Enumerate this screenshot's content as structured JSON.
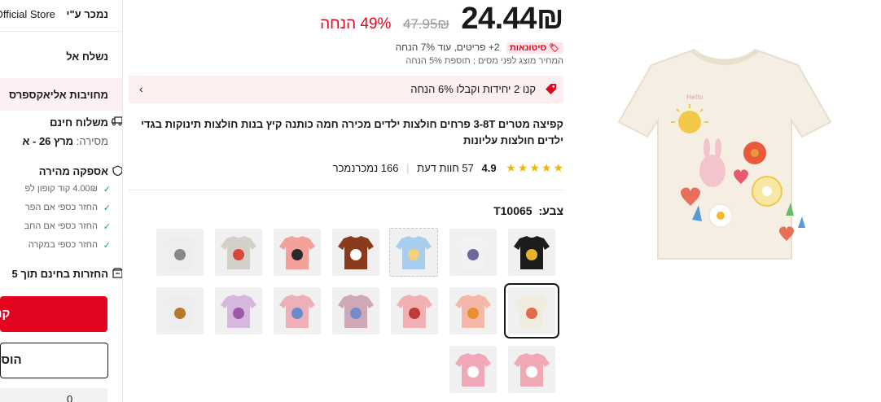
{
  "left": {
    "seller_label": "נמכר ע\"י",
    "store_name": "Official Store",
    "ship_to": "נשלח אל",
    "commitment": "מחויבות אליאקספרס",
    "free_shipping": "משלוח חינם",
    "delivery_label": "מסירה:",
    "delivery_date": "מרץ 26 - א",
    "fast_delivery": "אספקה מהירה",
    "benefits": [
      "4.00₪ קוד קופון לפ",
      "החזר כספי אם הפר",
      "החזר כספי אם החב",
      "החזר כספי במקרה"
    ],
    "free_returns": "החזרות בחינם תוך 5",
    "buy_label": "קנ",
    "add_label": "הוסי",
    "qty": "0"
  },
  "price": {
    "current": "24.44₪",
    "original": "47.95₪",
    "discount": "49% הנחה",
    "wholesale_badge": "סיטונאות",
    "wholesale_text": "2+ פריטים, עוד 7% הנחה",
    "tax_note": "המחיר מוצג לפני מסים ; תוספת 5% הנחה"
  },
  "coupon": {
    "text": "קנו 2 יחידות וקבלו 6% הנחה"
  },
  "product": {
    "title": "קפיצה מטרים 3-8T פרחים חולצות ילדים מכירה חמה כותנה קיץ בנות חולצות תינוקות בגדי ילדים חולצות עליונות",
    "rating": "4.9",
    "reviews": "57 חוות דעת",
    "sold": "166 נמכרנמכר"
  },
  "color": {
    "label": "צבע:",
    "value": "T10065"
  },
  "colors": {
    "accent": "#e3051f",
    "pink_bg": "#fdeef0",
    "star": "#f5b400",
    "check": "#1a9d5a"
  },
  "swatches": [
    {
      "name": "black-leopard",
      "shirt": "#1c1c1c",
      "accent": "#e8b430"
    },
    {
      "name": "white-butterfly",
      "shirt": "#f2f2f4",
      "accent": "#6a6a9a"
    },
    {
      "name": "blue-unicorn",
      "shirt": "#a9cdee",
      "accent": "#f2d27a"
    },
    {
      "name": "brown-zebra",
      "shirt": "#8a3b1e",
      "accent": "#ffffff"
    },
    {
      "name": "pink-toucan",
      "shirt": "#f2a099",
      "accent": "#2a2a2a"
    },
    {
      "name": "gray-flowers",
      "shirt": "#d2d0c8",
      "accent": "#d8463c"
    },
    {
      "name": "white-dancer",
      "shirt": "#ededed",
      "accent": "#888"
    },
    {
      "name": "cream-flowers",
      "shirt": "#f2ece0",
      "accent": "#e36a4a"
    },
    {
      "name": "peach-fox",
      "shirt": "#f4b8a8",
      "accent": "#e89030"
    },
    {
      "name": "pink-butterfly",
      "shirt": "#f2b0b2",
      "accent": "#c03a3a"
    },
    {
      "name": "mauve-unicorn",
      "shirt": "#cfa8b8",
      "accent": "#7a8ac8"
    },
    {
      "name": "pink-unicorn",
      "shirt": "#eeb0b8",
      "accent": "#6a8ad0"
    },
    {
      "name": "lilac-unicorn",
      "shirt": "#d6b8dc",
      "accent": "#9a5aa8"
    },
    {
      "name": "white-bear",
      "shirt": "#ededed",
      "accent": "#b8782a"
    },
    {
      "name": "pink-ruffle",
      "shirt": "#f0a8b4",
      "accent": "#ffffff"
    },
    {
      "name": "pink-bunny",
      "shirt": "#f0a8b8",
      "accent": "#ffffff"
    }
  ]
}
